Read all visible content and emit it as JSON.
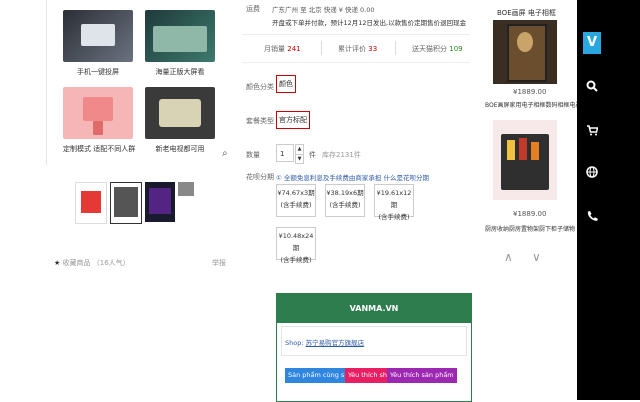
{
  "gallery": {
    "items": [
      {
        "caption": "手机一键投屏"
      },
      {
        "caption": "海量正版大屏看"
      },
      {
        "caption": "定制模式 适配不同人群"
      },
      {
        "caption": "新老电视都可用"
      }
    ],
    "favorite": "收藏商品 （16人气）",
    "report": "举报"
  },
  "product": {
    "shipping_label": "运费",
    "shipping_text": "广东广州 至 北京 快递 ¥ 快递 0.00",
    "promo_text": "开盘或下单并付款，预计12月12日发出,以款售价定期售价退回现金",
    "stats": [
      {
        "label": "月销量",
        "value": "241",
        "color": "#c00"
      },
      {
        "label": "累计评价",
        "value": "33",
        "color": "#c00"
      },
      {
        "label": "送天猫积分",
        "value": "109",
        "color": "#2a8a2a"
      }
    ],
    "color_label": "颜色分类",
    "color_option": "颜色",
    "package_label": "套餐类型",
    "package_option": "官方标配",
    "qty_label": "数量",
    "qty_value": "1",
    "qty_unit": "件",
    "stock": "库存2131件",
    "installment_label": "花呗分期",
    "installment_note": "① 全额免息利息及手续费由商家承担  什么是花呗分期",
    "installments": [
      {
        "amount": "¥74.67x3期",
        "fee": "(含手续费)"
      },
      {
        "amount": "¥38.19x6期",
        "fee": "(含手续费)"
      },
      {
        "amount": "¥19.61x12期",
        "fee": "(含手续费)"
      },
      {
        "amount": "¥10.48x24期",
        "fee": "(含手续费)"
      }
    ]
  },
  "vanma": {
    "title": "VANMA.VN",
    "shop_prefix": "Shop:",
    "shop_name": "苏宁易购官方旗舰店",
    "buttons": [
      {
        "label": "Sản phẩm cùng shop",
        "color": "#2e86de"
      },
      {
        "label": "Yêu thích shop",
        "color": "#e91e63"
      },
      {
        "label": "Yêu thích sản phẩm",
        "color": "#9c27b0"
      }
    ]
  },
  "recommend": {
    "header": "BOE画屏 电子相框",
    "items": [
      {
        "price": "¥1889.00",
        "title": "BOE画屏家用电子相框数码相框电视"
      },
      {
        "price": "¥1889.00",
        "title": "厨房收纳厨房置物架厨下柜子储物"
      }
    ],
    "nav_up": "∧",
    "nav_down": "∨"
  },
  "sidebar": {
    "logo": "V",
    "icons": [
      "search-icon",
      "cart-icon",
      "globe-icon",
      "phone-icon"
    ]
  }
}
